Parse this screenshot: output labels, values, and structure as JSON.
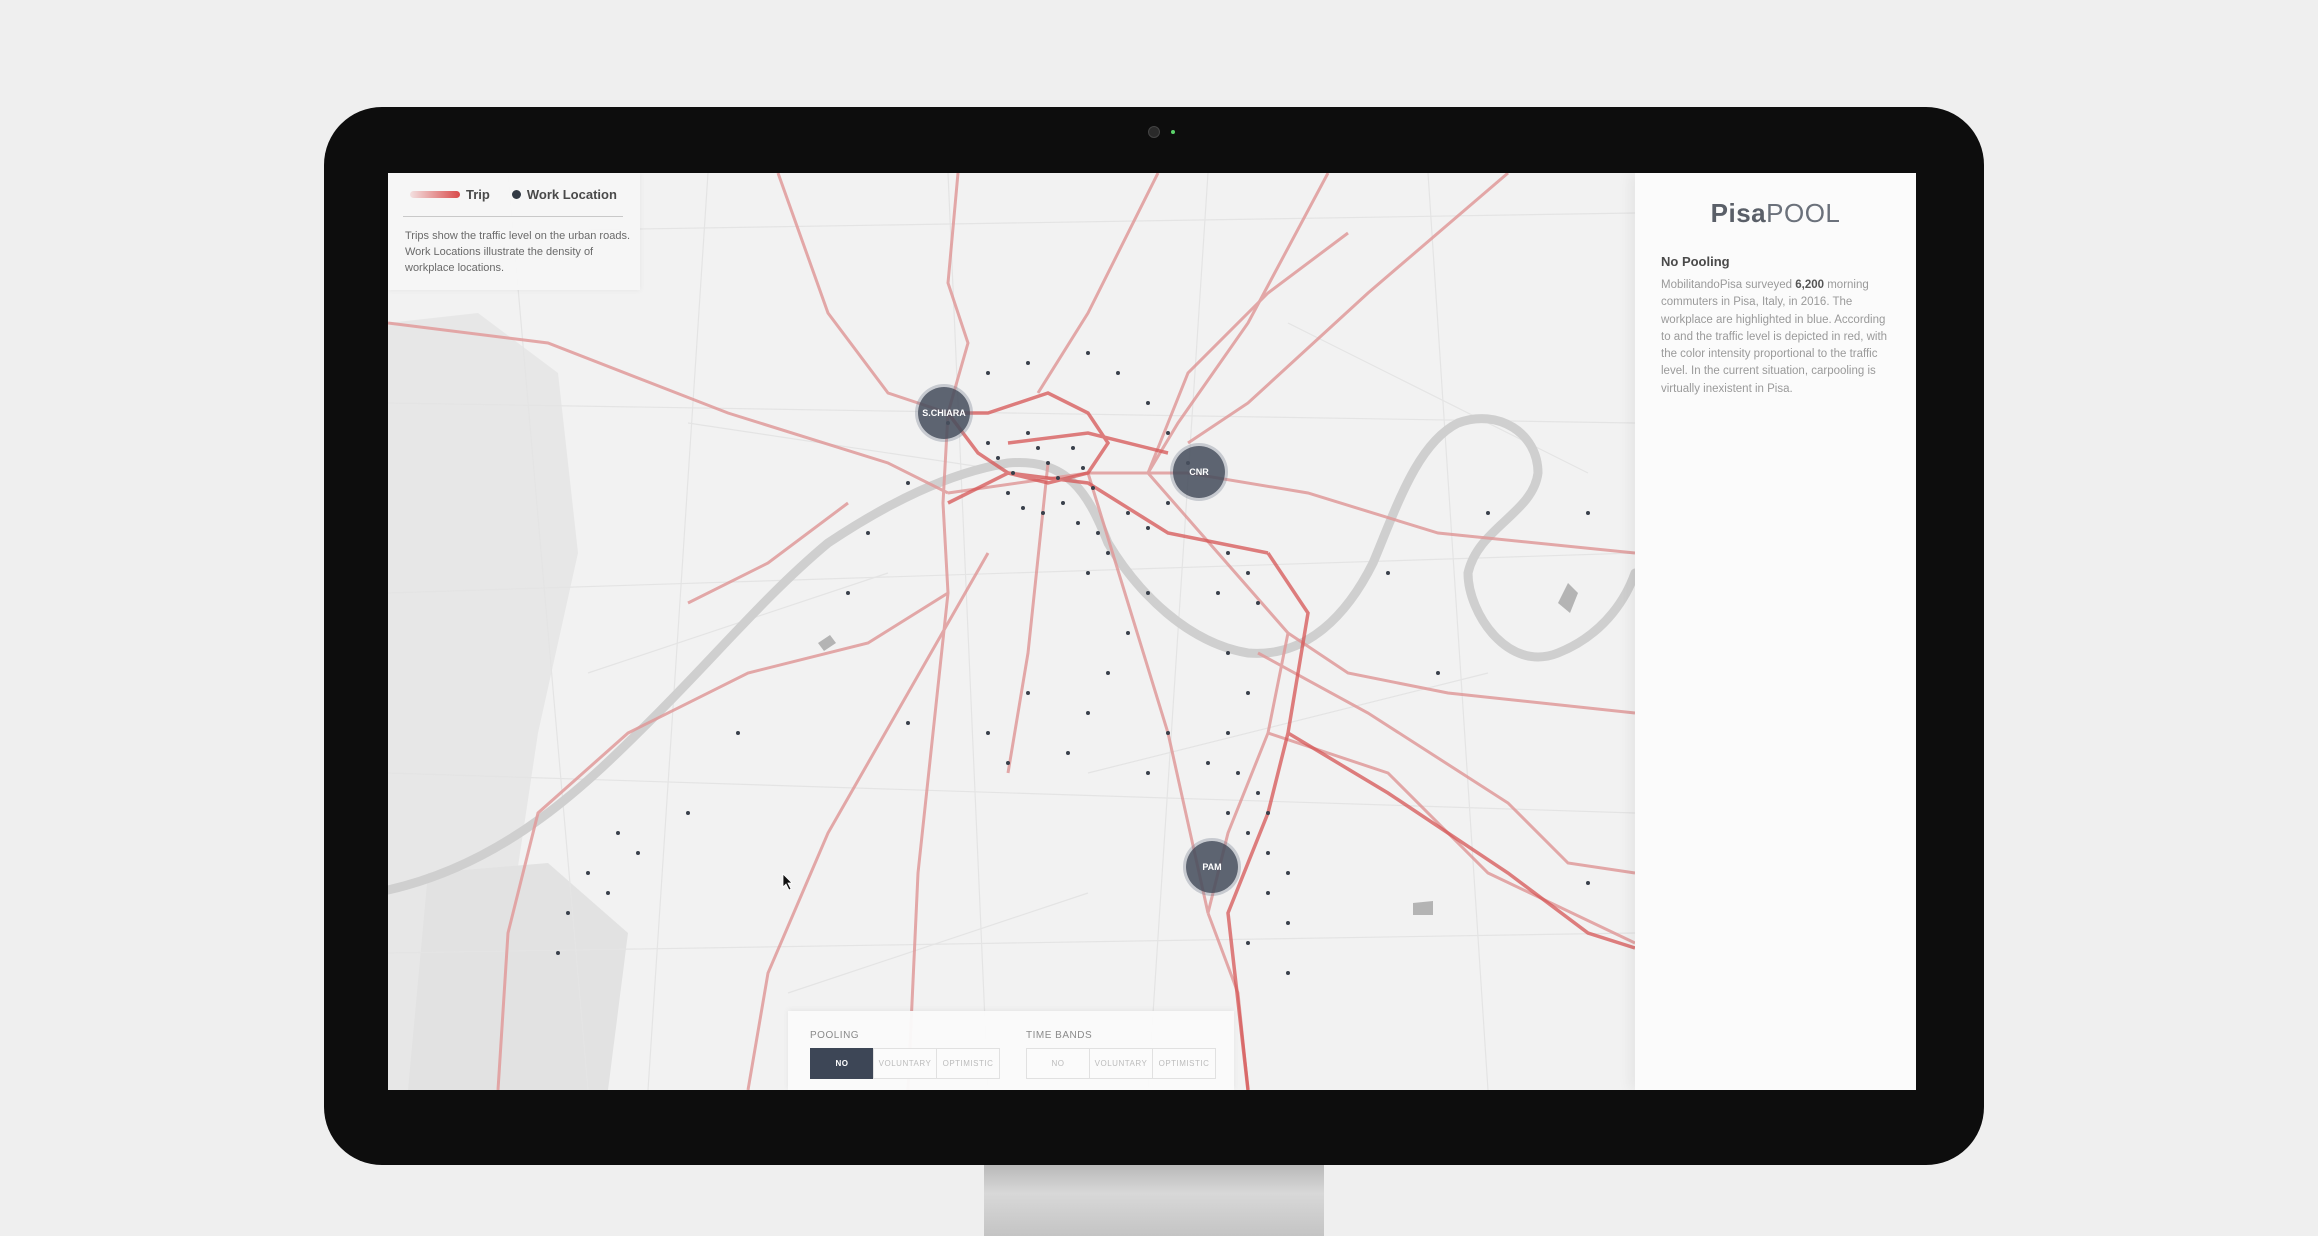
{
  "legend": {
    "trip_label": "Trip",
    "work_label": "Work Location",
    "description": "Trips show the traffic level on the urban roads. Work Locations illustrate the density of workplace locations."
  },
  "hubs": {
    "schiara": "S.CHIARA",
    "cnr": "CNR",
    "pam": "PAM"
  },
  "controls": {
    "pooling_title": "POOLING",
    "pooling_options": [
      "NO",
      "VOLUNTARY",
      "OPTIMISTIC"
    ],
    "pooling_selected": "NO",
    "timebands_title": "TIME BANDS",
    "timebands_options": [
      "NO",
      "VOLUNTARY",
      "OPTIMISTIC"
    ]
  },
  "panel": {
    "brand_bold": "Pisa",
    "brand_light": "POOL",
    "title": "No Pooling",
    "text_before": "MobilitandoPisa surveyed ",
    "text_number": "6,200",
    "text_after": " morning commuters in Pisa, Italy, in 2016. The workplace are highlighted in blue. According to and the traffic level is depicted in red, with the color intensity proportional to the traffic level. In the current situation, carpooling is virtually inexistent in Pisa."
  },
  "colors": {
    "trip": "#d94a4a",
    "work_location": "#333a44",
    "hub": "#48505e",
    "active_button": "#3d4656"
  }
}
